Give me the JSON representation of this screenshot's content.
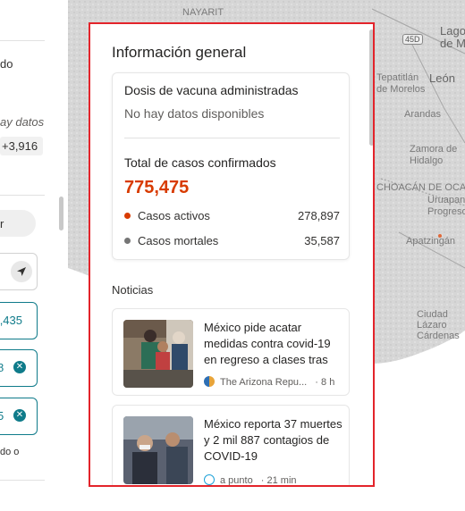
{
  "left_panel": {
    "frag_do": "do",
    "frag_hay_datos": "ay datos",
    "frag_delta": "+3,916",
    "frag_r": "r",
    "frag_435": ",435",
    "frag_8": "8",
    "frag_5": "5",
    "frag_do_o": "do o"
  },
  "map": {
    "labels": {
      "nayarit": "NAYARIT",
      "lagos": "Lagos",
      "de_mo": "de Mo",
      "leon": "León",
      "tepatitlan": "Tepatitlán",
      "de_morelos": "de Morelos",
      "arandas": "Arandas",
      "zamora": "Zamora de",
      "hidalgo": "Hidalgo",
      "michoacan": "CHOACÁN DE OCAMP",
      "uruapan": "Uruapan",
      "progreso": "Progreso",
      "apatzingan": "Apatzingán",
      "ciudad": "Ciudad",
      "lazaro": "Lázaro",
      "cardenas": "Cárdenas",
      "hwy_45d": "45D"
    }
  },
  "card": {
    "title": "Información general",
    "vaccine_label": "Dosis de vacuna administradas",
    "vaccine_value": "No hay datos disponibles",
    "confirmed_label": "Total de casos confirmados",
    "confirmed_value": "775,475",
    "active_label": "Casos activos",
    "active_value": "278,897",
    "deaths_label": "Casos mortales",
    "deaths_value": "35,587",
    "news_heading": "Noticias",
    "news": [
      {
        "title": "México pide acatar medidas contra covid-19 en regreso a clases tras",
        "source": "The Arizona Repu...",
        "time": "· 8 h"
      },
      {
        "title": "México reporta 37 muertes y 2 mil 887 contagios de COVID-19",
        "source": "a punto",
        "time": "· 21 min"
      }
    ]
  },
  "colors": {
    "accent_red": "#d83b01",
    "active_dot": "#d83b01",
    "deaths_dot": "#757575",
    "highlight_border": "#e3242b",
    "teal": "#0f7b8a"
  }
}
